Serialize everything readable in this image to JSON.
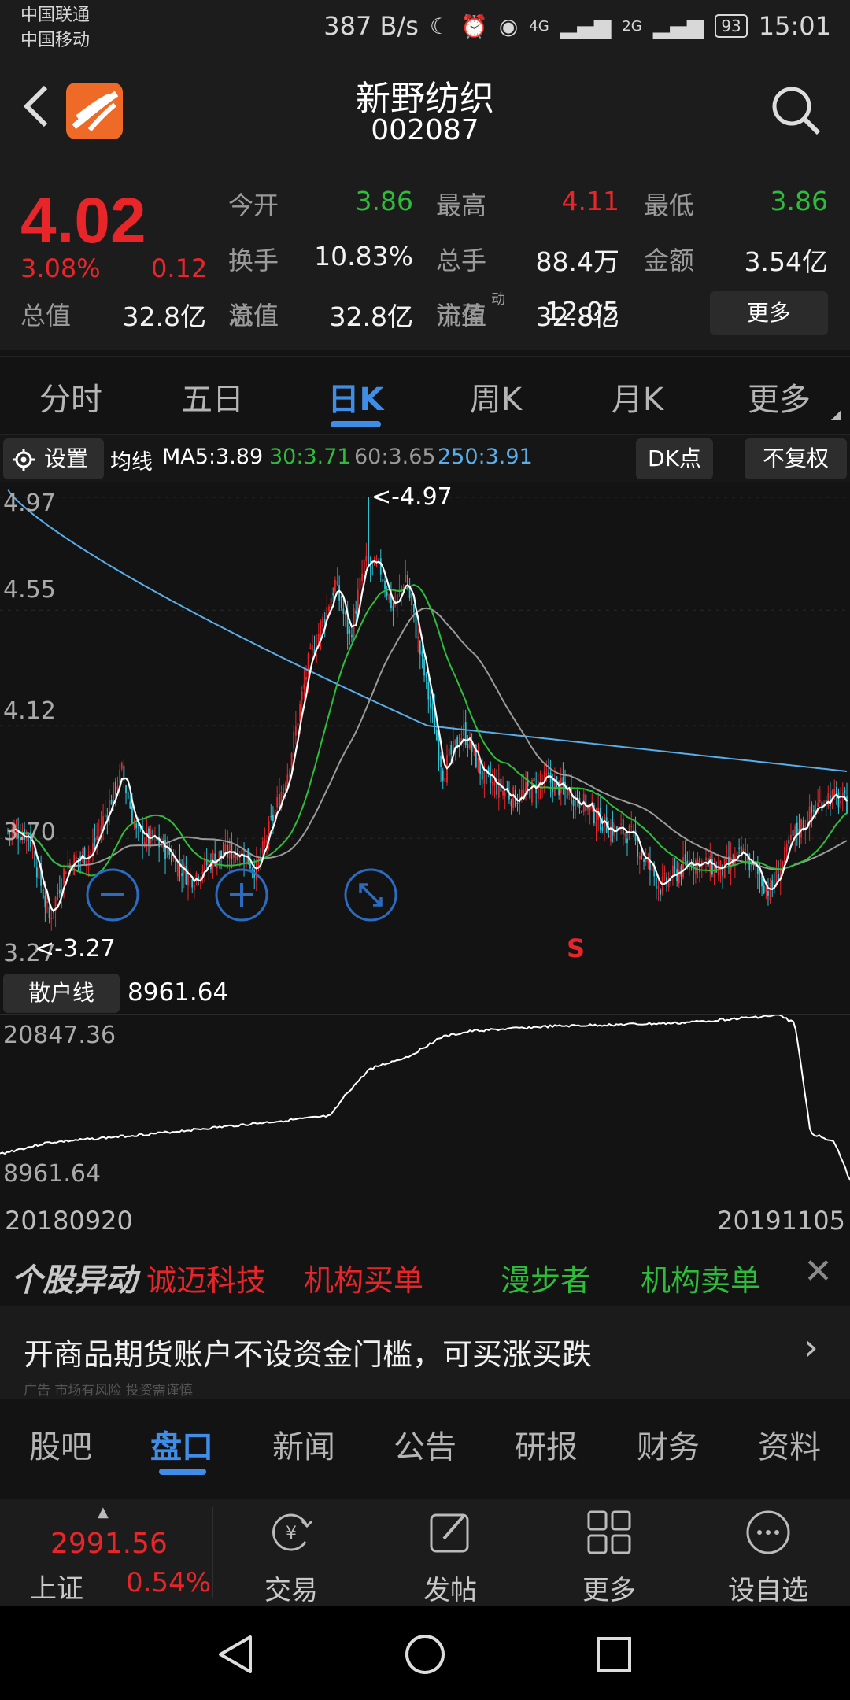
{
  "status_bar": {
    "carrier1": "中国联通",
    "carrier2": "中国移动",
    "speed": "387 B/s",
    "network1": "4G",
    "network2": "2G",
    "battery": "93",
    "time": "15:01"
  },
  "header": {
    "stock_name": "新野纺织",
    "stock_code": "002087",
    "icons": [
      "back-icon",
      "app-logo",
      "search-icon"
    ]
  },
  "quote": {
    "price": "4.02",
    "change_pct": "3.08%",
    "change": "0.12",
    "fields": [
      {
        "label": "今开",
        "value": "3.86",
        "color": "#2ebd3a"
      },
      {
        "label": "最高",
        "value": "4.11",
        "color": "#e8262a"
      },
      {
        "label": "最低",
        "value": "3.86",
        "color": "#2ebd3a"
      },
      {
        "label": "换手",
        "value": "10.83%",
        "color": "#f2f2f2"
      },
      {
        "label": "总手",
        "value": "88.4万",
        "color": "#f2f2f2"
      },
      {
        "label": "金额",
        "value": "3.54亿",
        "color": "#f2f2f2"
      },
      {
        "label": "总值",
        "value": "32.8亿",
        "color": "#f2f2f2"
      },
      {
        "label": "流值",
        "value": "32.8亿",
        "color": "#f2f2f2"
      },
      {
        "label": "市盈",
        "value": "12.05",
        "color": "#f2f2f2",
        "superscript": "动"
      }
    ],
    "more_label": "更多"
  },
  "chart_tabs": [
    "分时",
    "五日",
    "日K",
    "周K",
    "月K",
    "更多"
  ],
  "chart_tab_active": "日K",
  "indicator_bar": {
    "settings_label": "设置",
    "ma_label": "均线",
    "ma5": "MA5:3.89",
    "ma30": "30:3.71",
    "ma60": "60:3.65",
    "ma250": "250:3.91",
    "dk_label": "DK点",
    "adjust_label": "不复权",
    "colors": {
      "ma5": "#ffffff",
      "ma30": "#2ebd3a",
      "ma60": "#9a9a9a",
      "ma250": "#5aaeea"
    }
  },
  "kline": {
    "axis_labels": [
      "4.97",
      "4.55",
      "4.12",
      "3.70",
      "3.27"
    ],
    "max_marker": "<-4.97",
    "min_marker": "<-3.27",
    "signal_marker": "S",
    "zoom_out_icon": "zoom-out-icon",
    "zoom_in_icon": "zoom-in-icon",
    "expand_icon": "expand-icon"
  },
  "retail": {
    "button_label": "散户线",
    "value": "8961.64",
    "axis_max": "20847.36",
    "axis_min": "8961.64",
    "date_start": "20180920",
    "date_end": "20191105"
  },
  "ticker": {
    "title": "个股异动",
    "items": [
      {
        "text": "诚迈科技",
        "color": "#e8262a"
      },
      {
        "text": "机构买单",
        "color": "#e8262a"
      },
      {
        "text": "漫步者",
        "color": "#2ebd3a"
      },
      {
        "text": "机构卖单",
        "color": "#2ebd3a"
      }
    ]
  },
  "ad": {
    "text": "开商品期货账户不设资金门槛，可买涨买跌",
    "note": "广告 市场有风险 投资需谨慎"
  },
  "section_tabs": [
    "股吧",
    "盘口",
    "新闻",
    "公告",
    "研报",
    "财务",
    "资料"
  ],
  "section_tab_active": "盘口",
  "bottom_bar": {
    "index_value": "2991.56",
    "index_name": "上证",
    "index_pct": "0.54%",
    "tools": [
      {
        "label": "交易",
        "icon": "trade-icon"
      },
      {
        "label": "发帖",
        "icon": "post-icon"
      },
      {
        "label": "更多",
        "icon": "grid-icon"
      },
      {
        "label": "设自选",
        "icon": "add-watchlist-icon"
      }
    ]
  }
}
